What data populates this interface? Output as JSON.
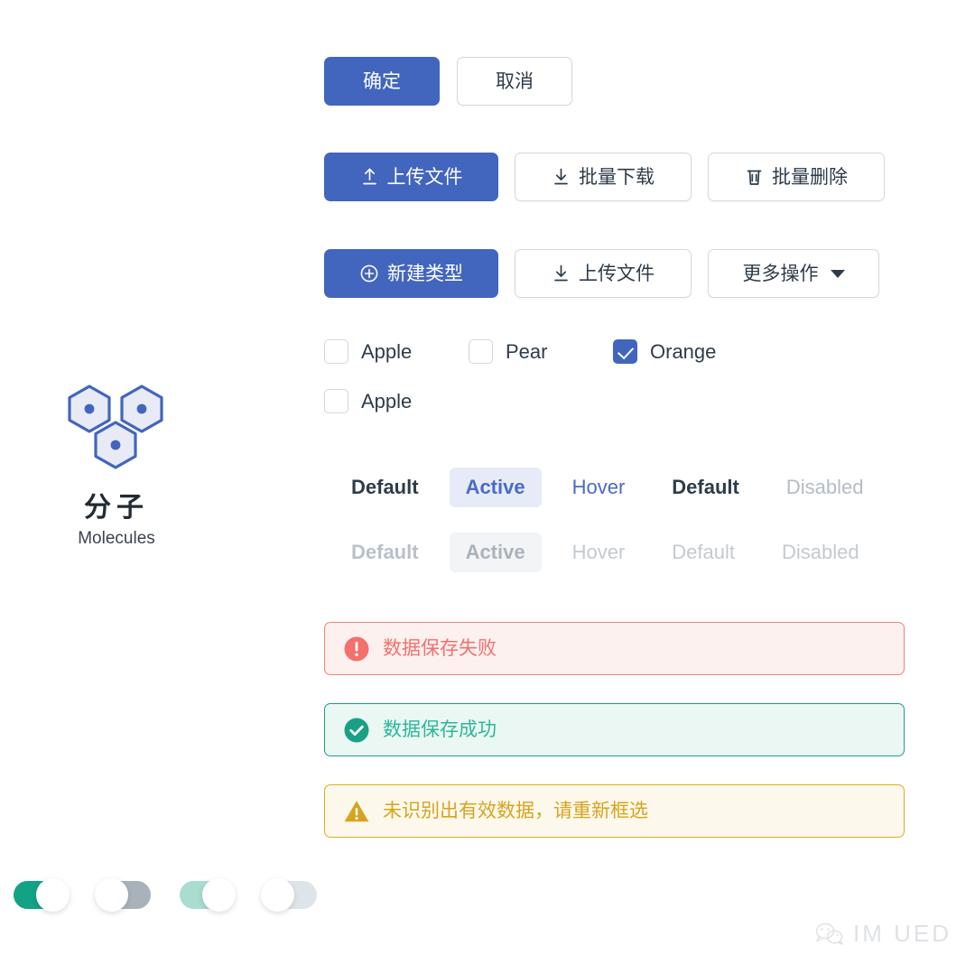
{
  "category": {
    "icon": "molecules-hexagon-icon",
    "name_cn": "分子",
    "name_en": "Molecules"
  },
  "buttons": {
    "confirm_row": [
      {
        "label": "确定",
        "style": "primary",
        "icon": null
      },
      {
        "label": "取消",
        "style": "default",
        "icon": null
      }
    ],
    "file_ops_row": [
      {
        "label": "上传文件",
        "style": "primary",
        "icon": "upload-icon"
      },
      {
        "label": "批量下载",
        "style": "default",
        "icon": "download-icon"
      },
      {
        "label": "批量删除",
        "style": "default",
        "icon": "trash-icon"
      }
    ],
    "type_ops_row": [
      {
        "label": "新建类型",
        "style": "primary",
        "icon": "plus-circle-icon"
      },
      {
        "label": "上传文件",
        "style": "default",
        "icon": "download-icon"
      },
      {
        "label": "更多操作",
        "style": "default",
        "icon": "chevron-down-icon"
      }
    ]
  },
  "checkboxes": {
    "row1": [
      {
        "label": "Apple",
        "checked": false
      },
      {
        "label": "Pear",
        "checked": false
      },
      {
        "label": "Orange",
        "checked": true
      }
    ],
    "row2": [
      {
        "label": "Apple",
        "checked": false
      }
    ]
  },
  "states": {
    "enabled_row": [
      "Default",
      "Active",
      "Hover",
      "Default",
      "Disabled"
    ],
    "disabled_row": [
      "Default",
      "Active",
      "Hover",
      "Default",
      "Disabled"
    ]
  },
  "alerts": [
    {
      "type": "error",
      "icon": "exclamation-circle-icon",
      "message": "数据保存失败"
    },
    {
      "type": "success",
      "icon": "check-circle-icon",
      "message": "数据保存成功"
    },
    {
      "type": "warning",
      "icon": "warning-triangle-icon",
      "message": "未识别出有效数据，请重新框选"
    }
  ],
  "toggles": [
    {
      "state": "on",
      "disabled": false
    },
    {
      "state": "off",
      "disabled": false
    },
    {
      "state": "on",
      "disabled": true
    },
    {
      "state": "off",
      "disabled": true
    }
  ],
  "watermark": {
    "icon": "wechat-icon",
    "text": "IM UED"
  },
  "colors": {
    "primary_blue": "#4265bd",
    "active_blue_text": "#4a6ac8",
    "active_pill_bg": "#e7ebf8",
    "text_dark": "#2e3c4a",
    "text_disabled": "#b3bcc4",
    "error": "#f4706d",
    "error_bg": "#fdf1f0",
    "success": "#18a187",
    "success_bg": "#eaf7f3",
    "warning": "#d7a41f",
    "warning_bg": "#fdf8ec",
    "toggle_on": "#11a383",
    "toggle_off": "#a7b2bb"
  }
}
